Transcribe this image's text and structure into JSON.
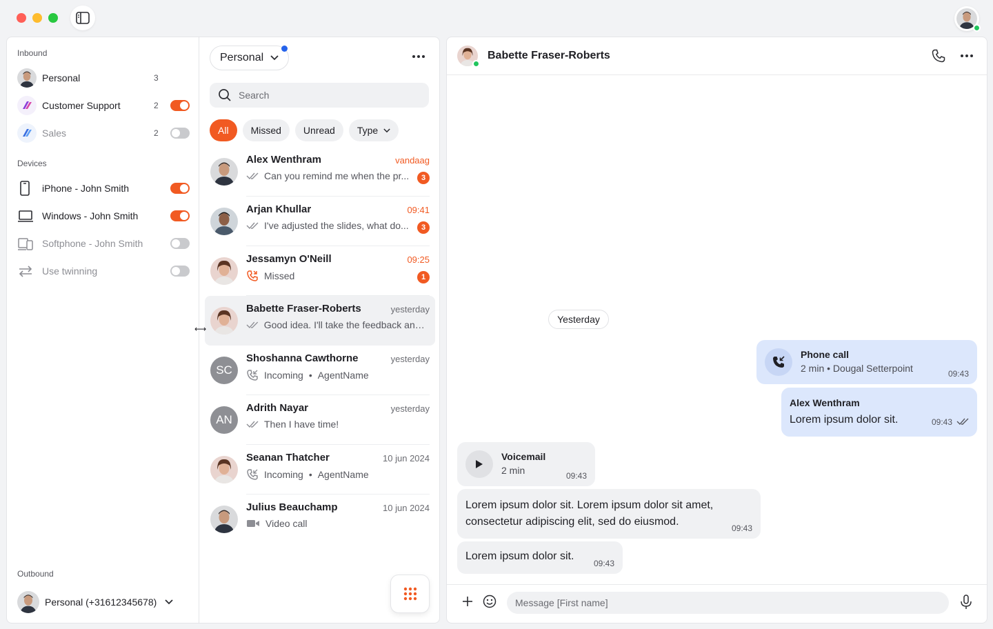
{
  "window": {
    "traffic_lights": [
      "close",
      "minimize",
      "zoom"
    ]
  },
  "sidebar": {
    "inbound_label": "Inbound",
    "inbound": [
      {
        "label": "Personal",
        "count": "3",
        "icon": "avatar",
        "toggle": null,
        "dim": false
      },
      {
        "label": "Customer Support",
        "count": "2",
        "icon": "purple-logo-icon",
        "toggle": "on",
        "dim": false
      },
      {
        "label": "Sales",
        "count": "2",
        "icon": "blue-logo-icon",
        "toggle": "off",
        "dim": true
      }
    ],
    "devices_label": "Devices",
    "devices": [
      {
        "label": "iPhone - John Smith",
        "icon": "phone-icon",
        "toggle": "on",
        "dim": false
      },
      {
        "label": "Windows - John Smith",
        "icon": "laptop-icon",
        "toggle": "on",
        "dim": false
      },
      {
        "label": "Softphone - John Smith",
        "icon": "softphone-icon",
        "toggle": "off",
        "dim": true
      },
      {
        "label": "Use twinning",
        "icon": "twinning-icon",
        "toggle": "off",
        "dim": true
      }
    ],
    "outbound_label": "Outbound",
    "outbound_value": "Personal (+31612345678)"
  },
  "conversations": {
    "inbox_select": "Personal",
    "search_placeholder": "Search",
    "filters": [
      {
        "label": "All",
        "active": true
      },
      {
        "label": "Missed",
        "active": false
      },
      {
        "label": "Unread",
        "active": false
      },
      {
        "label": "Type",
        "active": false,
        "dropdown": true
      }
    ],
    "items": [
      {
        "name": "Alex Wenthram",
        "time": "vandaag",
        "hot": true,
        "preview": "Can you remind me when the pr...",
        "preview_icon": "double-check-icon",
        "badge": "3",
        "avatar": "photo"
      },
      {
        "name": "Arjan Khullar",
        "time": "09:41",
        "hot": true,
        "preview": "I've adjusted the slides, what do...",
        "preview_icon": "double-check-icon",
        "badge": "3",
        "avatar": "photo"
      },
      {
        "name": "Jessamyn O'Neill",
        "time": "09:25",
        "hot": true,
        "preview": "Missed",
        "preview_icon": "missed-call-icon",
        "badge": "1",
        "avatar": "photo"
      },
      {
        "name": "Babette Fraser-Roberts",
        "time": "yesterday",
        "hot": false,
        "preview": "Good idea. I'll take the feedback and...",
        "preview_icon": "double-check-icon",
        "badge": null,
        "avatar": "photo",
        "selected": true
      },
      {
        "name": "Shoshanna Cawthorne",
        "time": "yesterday",
        "hot": false,
        "preview": "Incoming",
        "preview_agent": "AgentName",
        "preview_icon": "incoming-call-icon",
        "badge": null,
        "initials": "SC"
      },
      {
        "name": "Adrith Nayar",
        "time": "yesterday",
        "hot": false,
        "preview": "Then I have time!",
        "preview_icon": "double-check-icon",
        "badge": null,
        "initials": "AN"
      },
      {
        "name": "Seanan Thatcher",
        "time": "10 jun 2024",
        "hot": false,
        "preview": "Incoming",
        "preview_agent": "AgentName",
        "preview_icon": "incoming-call-icon",
        "badge": null,
        "avatar": "photo"
      },
      {
        "name": "Julius Beauchamp",
        "time": "10 jun 2024",
        "hot": false,
        "preview": "Video call",
        "preview_icon": "video-icon",
        "badge": null,
        "avatar": "photo"
      }
    ]
  },
  "chat": {
    "contact_name": "Babette Fraser-Roberts",
    "date_separator": "Yesterday",
    "phone_call": {
      "title": "Phone call",
      "duration": "2 min",
      "agent": "Dougal Setterpoint",
      "time": "09:43"
    },
    "outgoing_message": {
      "sender": "Alex Wenthram",
      "text": "Lorem ipsum dolor sit.",
      "time": "09:43"
    },
    "voicemail": {
      "title": "Voicemail",
      "duration": "2 min",
      "time": "09:43"
    },
    "incoming_long": {
      "text": "Lorem ipsum dolor sit. Lorem ipsum dolor sit amet, consectetur adipiscing elit, sed do eiusmod.",
      "time": "09:43"
    },
    "incoming_short": {
      "text": "Lorem ipsum dolor sit.",
      "time": "09:43"
    },
    "composer_placeholder": "Message [First name]"
  },
  "colors": {
    "accent": "#f15a22",
    "outgoing_bubble": "#dce7fc",
    "incoming_bubble": "#f0f1f3",
    "online": "#22c55e",
    "notification_dot": "#2563eb"
  }
}
